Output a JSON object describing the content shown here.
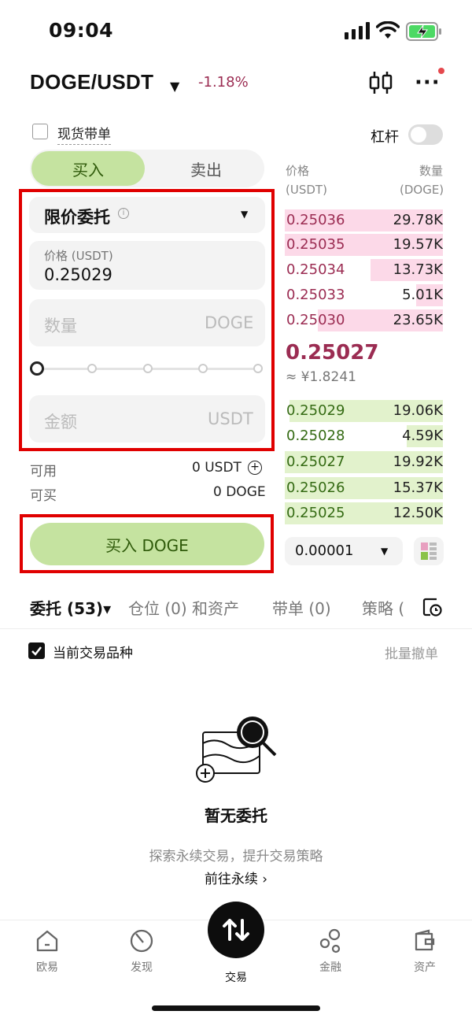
{
  "status_bar": {
    "time": "09:04"
  },
  "header": {
    "pair": "DOGE/USDT",
    "change": "-1.18%"
  },
  "spot_order": {
    "label": "现货带单"
  },
  "leverage": {
    "label": "杠杆",
    "enabled": false
  },
  "trade_tabs": {
    "buy": "买入",
    "sell": "卖出",
    "active": "buy"
  },
  "order_form": {
    "order_type": "限价委托",
    "price_label": "价格 (USDT)",
    "price_value": "0.25029",
    "qty_placeholder": "数量",
    "qty_unit": "DOGE",
    "amount_placeholder": "金额",
    "amount_unit": "USDT",
    "slider_percent": 0
  },
  "balance": {
    "available_label": "可用",
    "available_value": "0 USDT",
    "can_buy_label": "可买",
    "can_buy_value": "0 DOGE"
  },
  "submit_button": "买入 DOGE",
  "orderbook": {
    "price_header": "价格",
    "price_unit": "(USDT)",
    "qty_header": "数量",
    "qty_unit": "(DOGE)",
    "asks": [
      {
        "price": "0.25036",
        "qty": "29.78K",
        "depth": 1.0
      },
      {
        "price": "0.25035",
        "qty": "19.57K",
        "depth": 1.0
      },
      {
        "price": "0.25034",
        "qty": "13.73K",
        "depth": 0.46
      },
      {
        "price": "0.25033",
        "qty": "5.01K",
        "depth": 0.17
      },
      {
        "price": "0.25030",
        "qty": "23.65K",
        "depth": 0.79
      }
    ],
    "last_price": "0.25027",
    "last_price_cny": "≈ ¥1.8241",
    "bids": [
      {
        "price": "0.25029",
        "qty": "19.06K",
        "depth": 0.97
      },
      {
        "price": "0.25028",
        "qty": "4.59K",
        "depth": 0.23
      },
      {
        "price": "0.25027",
        "qty": "19.92K",
        "depth": 1.0
      },
      {
        "price": "0.25026",
        "qty": "15.37K",
        "depth": 1.0
      },
      {
        "price": "0.25025",
        "qty": "12.50K",
        "depth": 1.0
      }
    ],
    "tick_size": "0.00001"
  },
  "bottom_tabs": [
    {
      "label": "委托 (53)▾",
      "active": true
    },
    {
      "label": "仓位 (0) 和资产",
      "active": false
    },
    {
      "label": "带单 (0)",
      "active": false
    },
    {
      "label": "策略 (",
      "active": false
    }
  ],
  "filter": {
    "current_pair_label": "当前交易品种",
    "checked": true,
    "batch_cancel": "批量撤单"
  },
  "empty_state": {
    "title": "暂无委托",
    "subtitle": "探索永续交易，提升交易策略",
    "link": "前往永续 ›"
  },
  "nav": [
    {
      "label": "欧易",
      "icon": "home-icon"
    },
    {
      "label": "发现",
      "icon": "discover-icon"
    },
    {
      "label": "交易",
      "icon": "trade-swap-icon",
      "active": true
    },
    {
      "label": "金融",
      "icon": "finance-icon"
    },
    {
      "label": "资产",
      "icon": "wallet-icon"
    }
  ],
  "colors": {
    "buy_green": "#c5e3a0",
    "sell_red": "#9b2c52",
    "ask_bg": "#fcd9e8",
    "bid_bg": "#e2f2cc"
  }
}
